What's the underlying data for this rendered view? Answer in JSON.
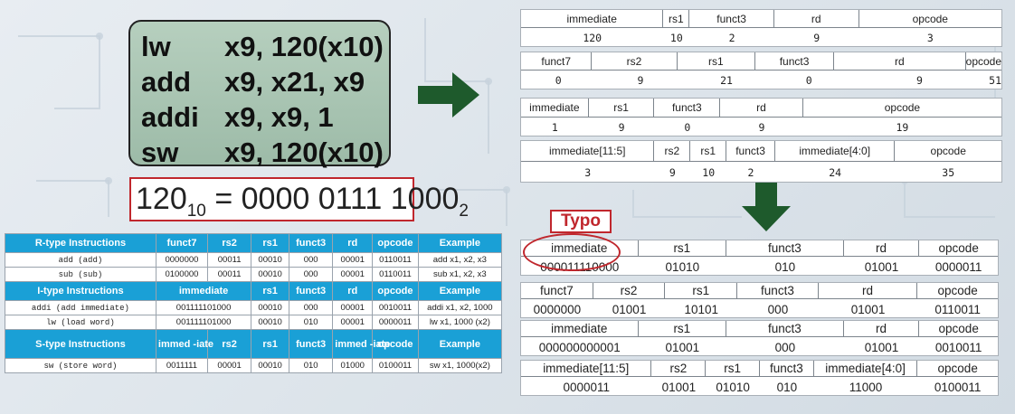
{
  "code_lines": [
    {
      "op": "lw",
      "args": "x9, 120(x10)"
    },
    {
      "op": "add",
      "args": "x9, x21, x9"
    },
    {
      "op": "addi",
      "args": "x9, x9, 1"
    },
    {
      "op": "sw",
      "args": "x9, 120(x10)"
    }
  ],
  "equation": {
    "lhs": "120",
    "lhs_sub": "10",
    "eq": " = ",
    "rhs": "0000 0111 1000",
    "rhs_sub": "2"
  },
  "ref_table": {
    "rtype_header": [
      "R-type Instructions",
      "funct7",
      "rs2",
      "rs1",
      "funct3",
      "rd",
      "opcode",
      "Example"
    ],
    "rtype_rows": [
      [
        "add (add)",
        "0000000",
        "00011",
        "00010",
        "000",
        "00001",
        "0110011",
        "add x1, x2, x3"
      ],
      [
        "sub (sub)",
        "0100000",
        "00011",
        "00010",
        "000",
        "00001",
        "0110011",
        "sub x1, x2, x3"
      ]
    ],
    "itype_header": [
      "I-type Instructions",
      "immediate",
      "rs1",
      "funct3",
      "rd",
      "opcode",
      "Example"
    ],
    "itype_rows": [
      [
        "addi (add immediate)",
        "001111101000",
        "00010",
        "000",
        "00001",
        "0010011",
        "addi x1, x2, 1000"
      ],
      [
        "lw (load word)",
        "001111101000",
        "00010",
        "010",
        "00001",
        "0000011",
        "lw x1, 1000 (x2)"
      ]
    ],
    "stype_header": [
      "S-type Instructions",
      "immed -iate",
      "rs2",
      "rs1",
      "funct3",
      "immed -iate",
      "opcode",
      "Example"
    ],
    "stype_rows": [
      [
        "sw (store word)",
        "0011111",
        "00001",
        "00010",
        "010",
        "01000",
        "0100011",
        "sw x1, 1000(x2)"
      ]
    ]
  },
  "decimal_formats": [
    {
      "headers": [
        "immediate",
        "rs1",
        "funct3",
        "rd",
        "opcode"
      ],
      "values": [
        "120",
        "10",
        "2",
        "9",
        "3"
      ]
    },
    {
      "headers": [
        "funct7",
        "rs2",
        "rs1",
        "funct3",
        "rd",
        "opcode"
      ],
      "values": [
        "0",
        "9",
        "21",
        "0",
        "9",
        "51"
      ]
    },
    {
      "headers": [
        "immediate",
        "rs1",
        "funct3",
        "rd",
        "opcode"
      ],
      "values": [
        "1",
        "9",
        "0",
        "9",
        "19"
      ]
    },
    {
      "headers": [
        "immediate[11:5]",
        "rs2",
        "rs1",
        "funct3",
        "immediate[4:0]",
        "opcode"
      ],
      "values": [
        "3",
        "9",
        "10",
        "2",
        "24",
        "35"
      ]
    }
  ],
  "binary_formats": [
    {
      "headers": [
        "immediate",
        "rs1",
        "funct3",
        "rd",
        "opcode"
      ],
      "values": [
        "000011110000",
        "01010",
        "010",
        "01001",
        "0000011"
      ]
    },
    {
      "headers": [
        "funct7",
        "rs2",
        "rs1",
        "funct3",
        "rd",
        "opcode"
      ],
      "values": [
        "0000000",
        "01001",
        "10101",
        "000",
        "01001",
        "0110011"
      ]
    },
    {
      "headers": [
        "immediate",
        "rs1",
        "funct3",
        "rd",
        "opcode"
      ],
      "values": [
        "000000000001",
        "01001",
        "000",
        "01001",
        "0010011"
      ]
    },
    {
      "headers": [
        "immediate[11:5]",
        "rs2",
        "rs1",
        "funct3",
        "immediate[4:0]",
        "opcode"
      ],
      "values": [
        "0000011",
        "01001",
        "01010",
        "010",
        "11000",
        "0100011"
      ]
    }
  ],
  "typo_label": "Typo",
  "colors": {
    "accent_red": "#c0272d",
    "arrow_green": "#1e5a2c",
    "table_header_blue": "#1aa0d6",
    "code_box_green": "#a8c5b1"
  }
}
